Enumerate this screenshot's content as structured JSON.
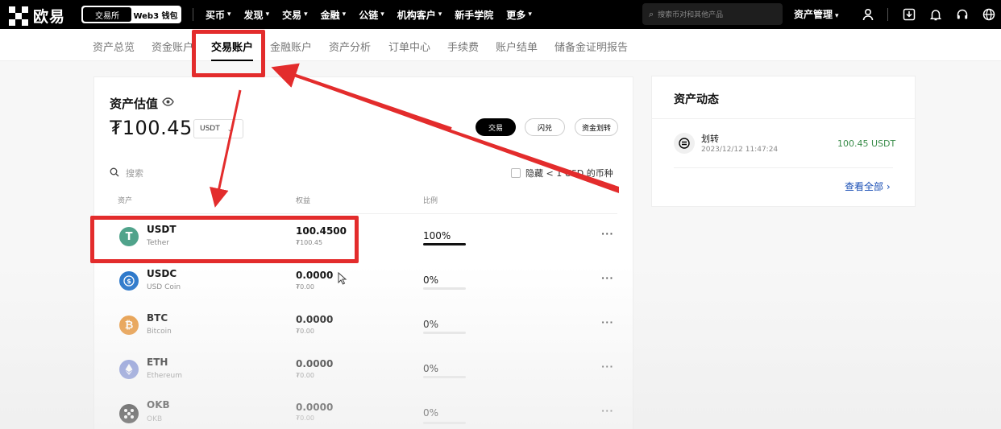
{
  "topbar": {
    "logo_text": "欧易",
    "segment": [
      "交易所",
      "Web3 钱包"
    ],
    "nav": [
      {
        "label": "买币",
        "chevron": true
      },
      {
        "label": "发现",
        "chevron": true
      },
      {
        "label": "交易",
        "chevron": true
      },
      {
        "label": "金融",
        "chevron": true
      },
      {
        "label": "公链",
        "chevron": true
      },
      {
        "label": "机构客户",
        "chevron": true
      },
      {
        "label": "新手学院",
        "chevron": false
      },
      {
        "label": "更多",
        "chevron": true
      }
    ],
    "search_placeholder": "搜索币对和其他产品",
    "asset_mgmt": "资产管理",
    "icons": [
      "user-icon",
      "download-icon",
      "bell-icon",
      "headset-icon",
      "globe-icon"
    ]
  },
  "subnav": {
    "items": [
      "资产总览",
      "资金账户",
      "交易账户",
      "金融账户",
      "资产分析",
      "订单中心",
      "手续费",
      "账户结单",
      "储备金证明报告"
    ],
    "active": "交易账户"
  },
  "valuation": {
    "title": "资产估值",
    "amount": "₮100.45",
    "currency": "USDT",
    "buttons": [
      "交易",
      "闪兑",
      "资金划转"
    ],
    "search_placeholder": "搜索",
    "hide_small_label": "隐藏 < 1 USD 的币种"
  },
  "table": {
    "headers": [
      "资产",
      "权益",
      "比例"
    ],
    "rows": [
      {
        "symbol": "USDT",
        "name": "Tether",
        "equity": "100.4500",
        "equity_sub": "₮100.45",
        "pct": "100%",
        "pct_value": 1.0,
        "icon": "tether-icon",
        "color": "#50a38b"
      },
      {
        "symbol": "USDC",
        "name": "USD Coin",
        "equity": "0.0000",
        "equity_sub": "₮0.00",
        "pct": "0%",
        "pct_value": 0.0,
        "icon": "usdc-icon",
        "color": "#2775ca"
      },
      {
        "symbol": "BTC",
        "name": "Bitcoin",
        "equity": "0.0000",
        "equity_sub": "₮0.00",
        "pct": "0%",
        "pct_value": 0.0,
        "icon": "bitcoin-icon",
        "color": "#e8963a"
      },
      {
        "symbol": "ETH",
        "name": "Ethereum",
        "equity": "0.0000",
        "equity_sub": "₮0.00",
        "pct": "0%",
        "pct_value": 0.0,
        "icon": "ethereum-icon",
        "color": "#7e8fd6"
      },
      {
        "symbol": "OKB",
        "name": "OKB",
        "equity": "0.0000",
        "equity_sub": "₮0.00",
        "pct": "0%",
        "pct_value": 0.0,
        "icon": "okb-icon",
        "color": "#000000"
      }
    ],
    "more_symbol": "···"
  },
  "activity": {
    "title": "资产动态",
    "items": [
      {
        "type": "划转",
        "time": "2023/12/12 11:47:24",
        "amount": "100.45 USDT"
      }
    ],
    "see_all": "查看全部 ›",
    "amount_color": "#3b8d4b"
  },
  "colors": {
    "annotation_red": "#e32c2c",
    "accent_black": "#000000"
  }
}
